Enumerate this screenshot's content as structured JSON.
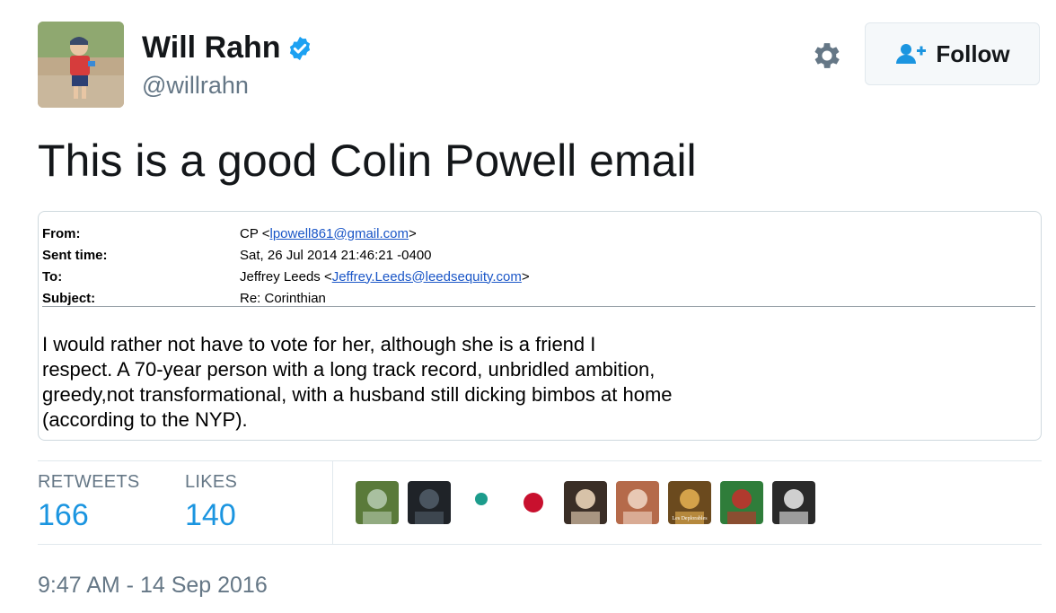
{
  "user": {
    "name": "Will Rahn",
    "handle": "@willrahn",
    "verified": true,
    "avatar_icon": "avatar-photo"
  },
  "actions": {
    "follow_label": "Follow",
    "follow_icon": "add-user-icon",
    "settings_icon": "gear-icon"
  },
  "tweet": {
    "text": "This is a good Colin Powell email"
  },
  "email": {
    "headers": [
      {
        "label": "From:",
        "prefix": "CP <",
        "link": "lpowell861@gmail.com",
        "suffix": ">"
      },
      {
        "label": "Sent time:",
        "prefix": "Sat, 26 Jul 2014 21:46:21 -0400",
        "link": "",
        "suffix": ""
      },
      {
        "label": "To:",
        "prefix": "Jeffrey Leeds <",
        "link": "Jeffrey.Leeds@leedsequity.com",
        "suffix": ">"
      },
      {
        "label": "Subject:",
        "prefix": "Re: Corinthian",
        "link": "",
        "suffix": ""
      }
    ],
    "body": "I would rather not have to vote for her, although she is a friend I\nrespect. A 70-year person with a long track record, unbridled ambition,\ngreedy,not transformational, with a husband still dicking bimbos at home\n(according to the NYP)."
  },
  "stats": {
    "retweets_label": "RETWEETS",
    "retweets_value": "166",
    "likes_label": "LIKES",
    "likes_value": "140"
  },
  "likers": [
    {
      "name": "liker-waterfall",
      "colors": [
        "#5a7a3a",
        "#a9c0a0"
      ]
    },
    {
      "name": "liker-suit-man",
      "colors": [
        "#1f2328",
        "#4a5560"
      ]
    },
    {
      "name": "liker-cartoon-face",
      "colors": [
        "#ffffff",
        "#1c9c8c"
      ]
    },
    {
      "name": "liker-red-sox-b",
      "colors": [
        "#ffffff",
        "#c8102e"
      ]
    },
    {
      "name": "liker-bearded-man",
      "colors": [
        "#3a2e26",
        "#d7c2a8"
      ]
    },
    {
      "name": "liker-woman-portrait",
      "colors": [
        "#b56a4a",
        "#e8c8b4"
      ]
    },
    {
      "name": "liker-les-deplorables",
      "colors": [
        "#6b4a1e",
        "#d4a24a"
      ],
      "caption": "Les Deplorables"
    },
    {
      "name": "liker-frog-cartoon",
      "colors": [
        "#2f7d3a",
        "#b03a2e"
      ]
    },
    {
      "name": "liker-newspaper-bw",
      "colors": [
        "#2a2a2a",
        "#cfcfcf"
      ]
    }
  ],
  "timestamp": "9:47 AM - 14 Sep 2016",
  "colors": {
    "accent": "#1b95e0",
    "verified_blue": "#1da1f2",
    "muted": "#657786"
  }
}
